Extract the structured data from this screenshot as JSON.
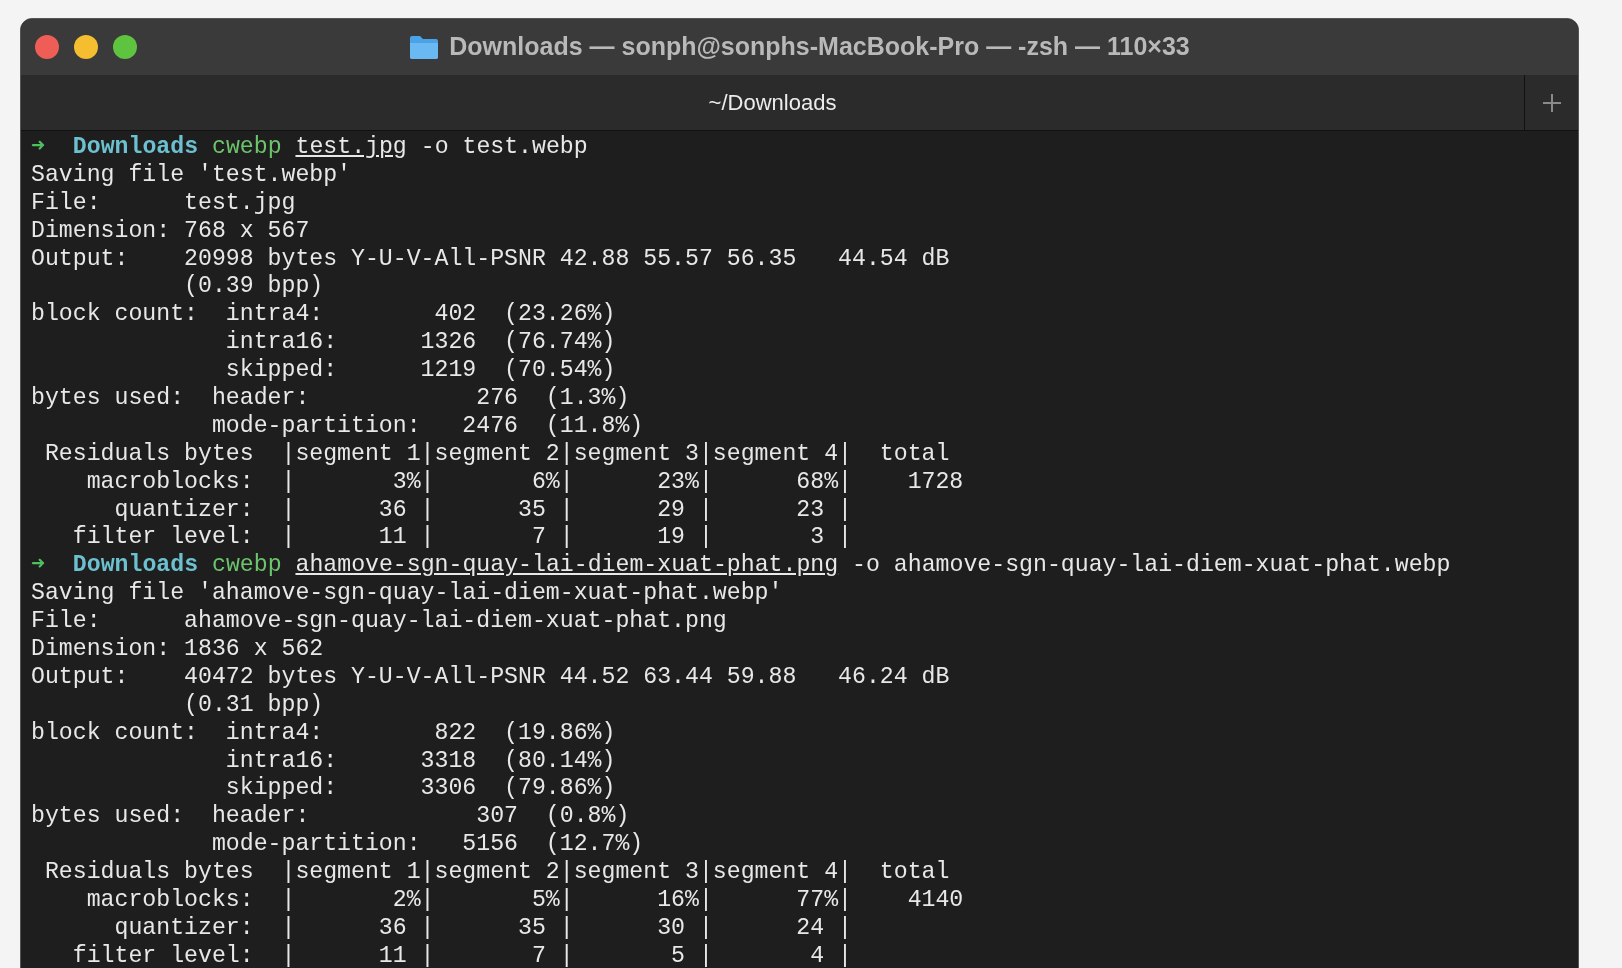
{
  "window": {
    "title": "Downloads — sonph@sonphs-MacBook-Pro — -zsh — 110×33"
  },
  "tabs": [
    {
      "label": "~/Downloads",
      "selected": true
    }
  ],
  "lines": [
    {
      "kind": "prompt",
      "arrow": "➜",
      "dir": "Downloads",
      "command": "cwebp",
      "file": "test.jpg",
      "rest": "-o test.webp"
    },
    {
      "kind": "output",
      "text": "Saving file 'test.webp'"
    },
    {
      "kind": "output",
      "text": "File:      test.jpg"
    },
    {
      "kind": "output",
      "text": "Dimension: 768 x 567"
    },
    {
      "kind": "output",
      "text": "Output:    20998 bytes Y-U-V-All-PSNR 42.88 55.57 56.35   44.54 dB"
    },
    {
      "kind": "output",
      "text": "           (0.39 bpp)"
    },
    {
      "kind": "output",
      "text": "block count:  intra4:        402  (23.26%)"
    },
    {
      "kind": "output",
      "text": "              intra16:      1326  (76.74%)"
    },
    {
      "kind": "output",
      "text": "              skipped:      1219  (70.54%)"
    },
    {
      "kind": "output",
      "text": "bytes used:  header:            276  (1.3%)"
    },
    {
      "kind": "output",
      "text": "             mode-partition:   2476  (11.8%)"
    },
    {
      "kind": "output",
      "text": " Residuals bytes  |segment 1|segment 2|segment 3|segment 4|  total"
    },
    {
      "kind": "output",
      "text": "    macroblocks:  |       3%|       6%|      23%|      68%|    1728"
    },
    {
      "kind": "output",
      "text": "      quantizer:  |      36 |      35 |      29 |      23 |"
    },
    {
      "kind": "output",
      "text": "   filter level:  |      11 |       7 |      19 |       3 |"
    },
    {
      "kind": "prompt",
      "arrow": "➜",
      "dir": "Downloads",
      "command": "cwebp",
      "file": "ahamove-sgn-quay-lai-diem-xuat-phat.png",
      "rest": "-o ahamove-sgn-quay-lai-diem-xuat-phat.webp"
    },
    {
      "kind": "output",
      "text": "Saving file 'ahamove-sgn-quay-lai-diem-xuat-phat.webp'"
    },
    {
      "kind": "output",
      "text": "File:      ahamove-sgn-quay-lai-diem-xuat-phat.png"
    },
    {
      "kind": "output",
      "text": "Dimension: 1836 x 562"
    },
    {
      "kind": "output",
      "text": "Output:    40472 bytes Y-U-V-All-PSNR 44.52 63.44 59.88   46.24 dB"
    },
    {
      "kind": "output",
      "text": "           (0.31 bpp)"
    },
    {
      "kind": "output",
      "text": "block count:  intra4:        822  (19.86%)"
    },
    {
      "kind": "output",
      "text": "              intra16:      3318  (80.14%)"
    },
    {
      "kind": "output",
      "text": "              skipped:      3306  (79.86%)"
    },
    {
      "kind": "output",
      "text": "bytes used:  header:            307  (0.8%)"
    },
    {
      "kind": "output",
      "text": "             mode-partition:   5156  (12.7%)"
    },
    {
      "kind": "output",
      "text": " Residuals bytes  |segment 1|segment 2|segment 3|segment 4|  total"
    },
    {
      "kind": "output",
      "text": "    macroblocks:  |       2%|       5%|      16%|      77%|    4140"
    },
    {
      "kind": "output",
      "text": "      quantizer:  |      36 |      35 |      30 |      24 |"
    },
    {
      "kind": "output",
      "text": "   filter level:  |      11 |       7 |       5 |       4 |"
    }
  ]
}
